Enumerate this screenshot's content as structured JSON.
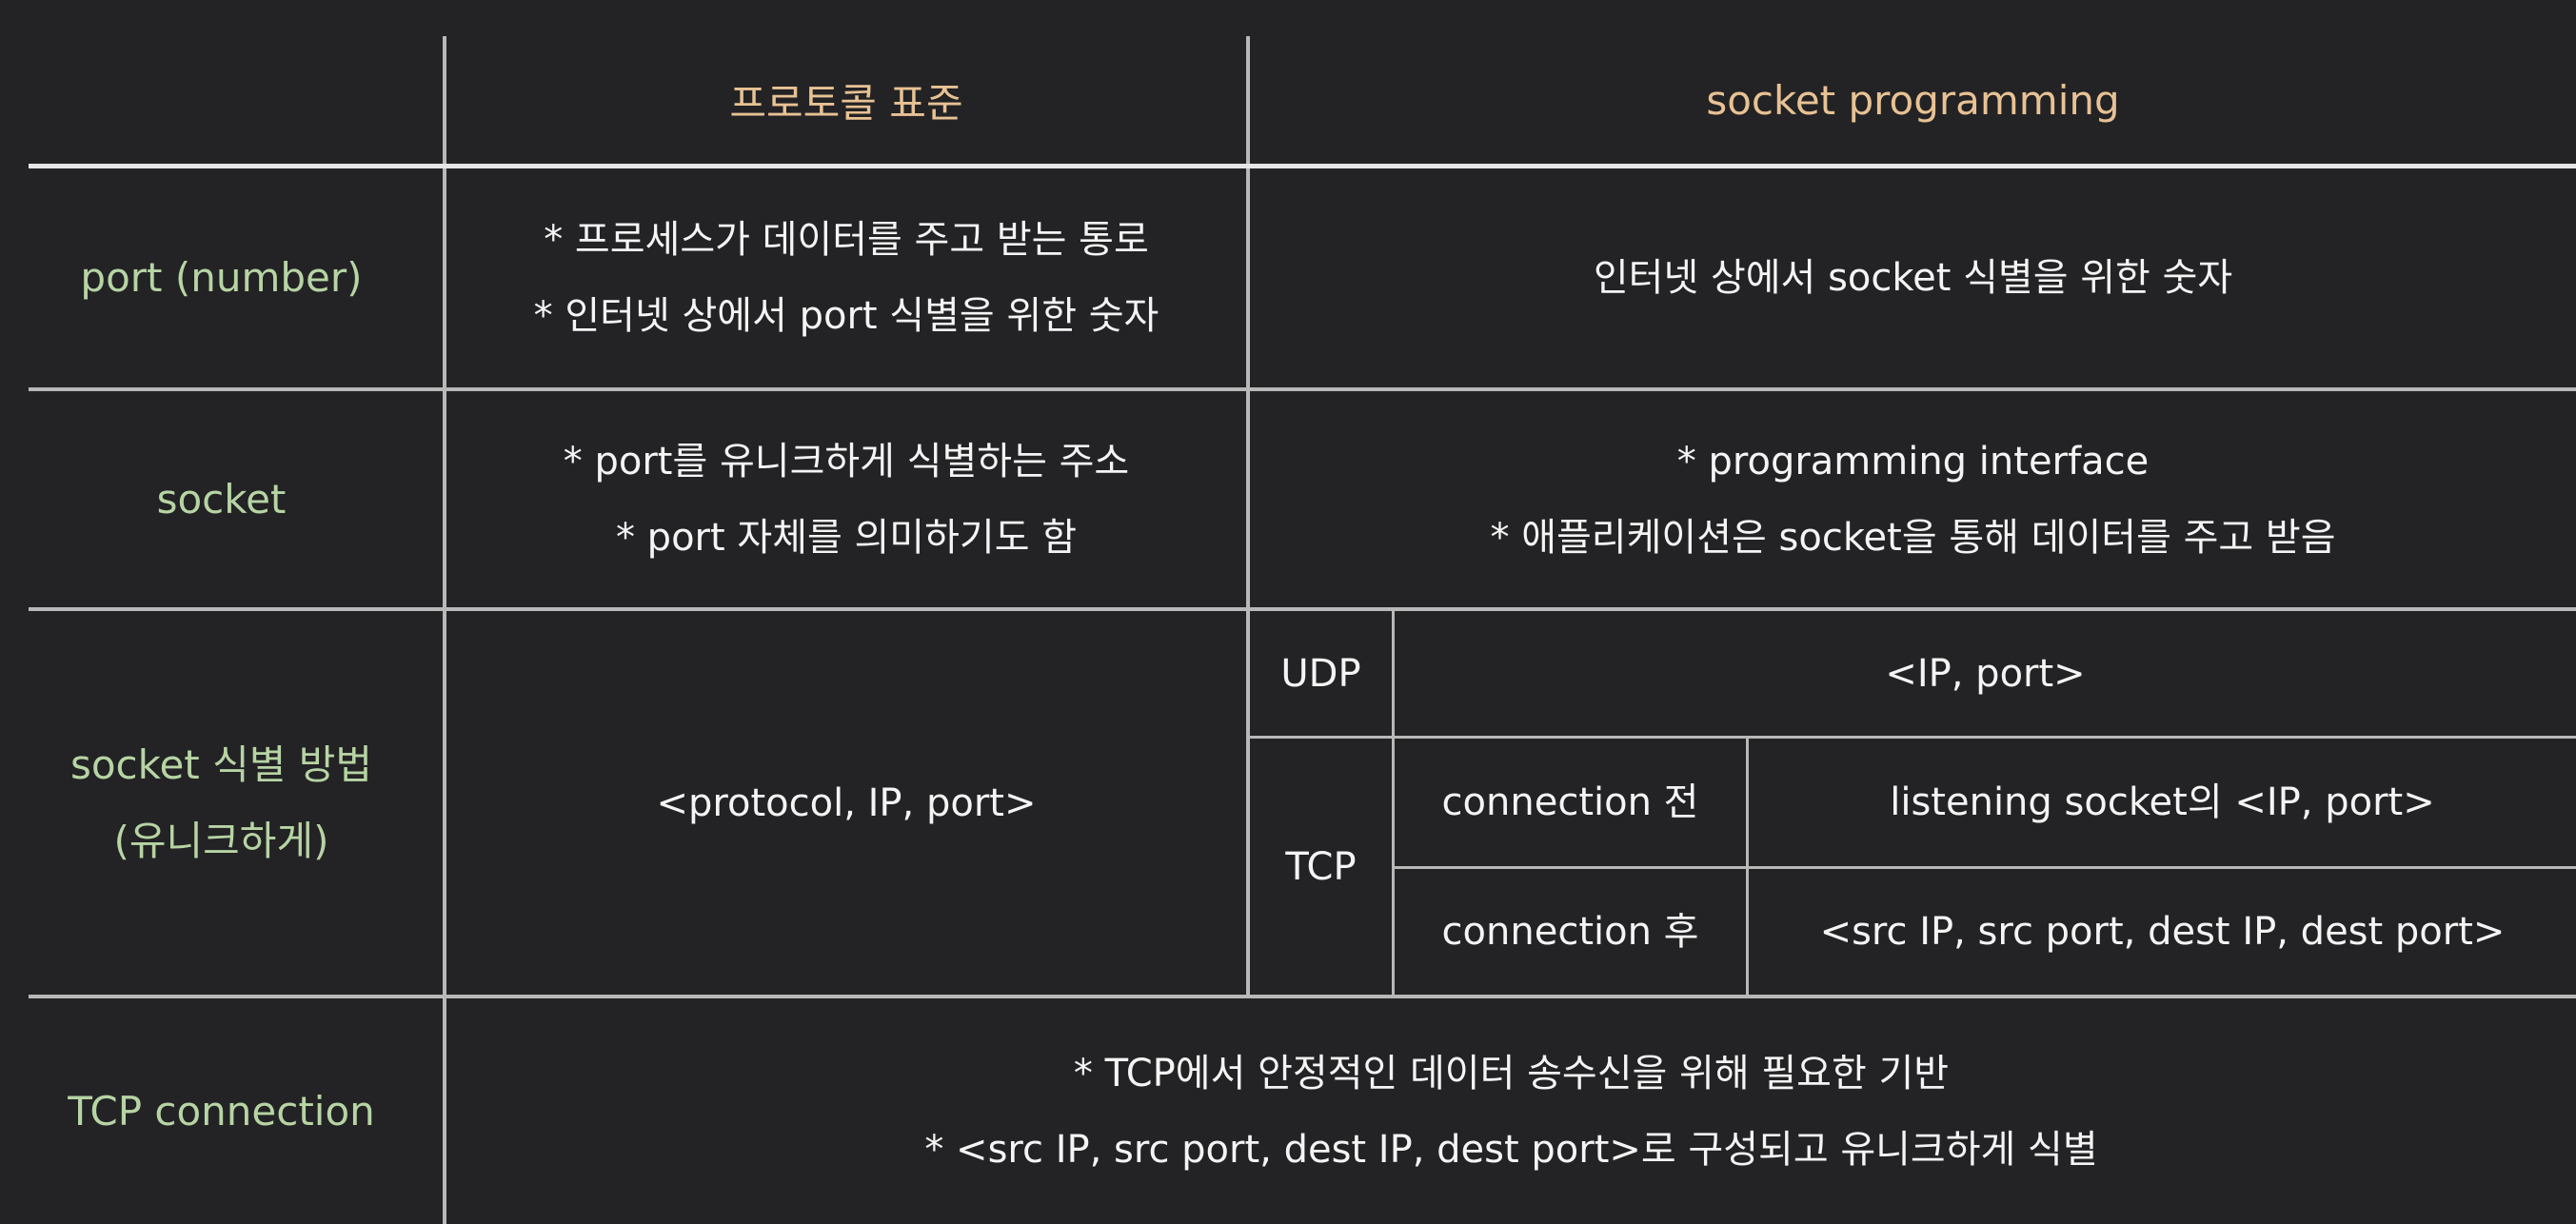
{
  "header": {
    "protocol_standard": "프로토콜 표준",
    "socket_programming": "socket programming"
  },
  "rows": {
    "port": {
      "label": "port (number)",
      "protocol_lines": [
        "* 프로세스가 데이터를 주고 받는 통로",
        "* 인터넷 상에서 port 식별을 위한 숫자"
      ],
      "socket_text": "인터넷 상에서 socket 식별을 위한 숫자"
    },
    "socket": {
      "label": "socket",
      "protocol_lines": [
        "* port를 유니크하게 식별하는 주소",
        "* port 자체를 의미하기도 함"
      ],
      "socket_lines": [
        "* programming interface",
        "* 애플리케이션은 socket을 통해 데이터를 주고 받음"
      ]
    },
    "identification": {
      "label_lines": [
        "socket 식별 방법",
        "(유니크하게)"
      ],
      "protocol_text": "<protocol, IP, port>",
      "udp_label": "UDP",
      "udp_value": "<IP, port>",
      "tcp_label": "TCP",
      "before_label": "connection 전",
      "before_value": "listening socket의 <IP, port>",
      "after_label": "connection 후",
      "after_value": "<src IP, src port, dest IP, dest port>"
    },
    "tcp_connection": {
      "label": "TCP connection",
      "lines": [
        "* TCP에서 안정적인 데이터 송수신을 위해 필요한 기반",
        "* <src IP, src port, dest IP, dest port>로 구성되고 유니크하게 식별"
      ]
    }
  },
  "colors": {
    "background": "#232325",
    "header_text": "#e8c294",
    "row_label_text": "#b7d4a4",
    "body_text": "#f4f4f4",
    "grid_line": "#b8b8b8"
  }
}
